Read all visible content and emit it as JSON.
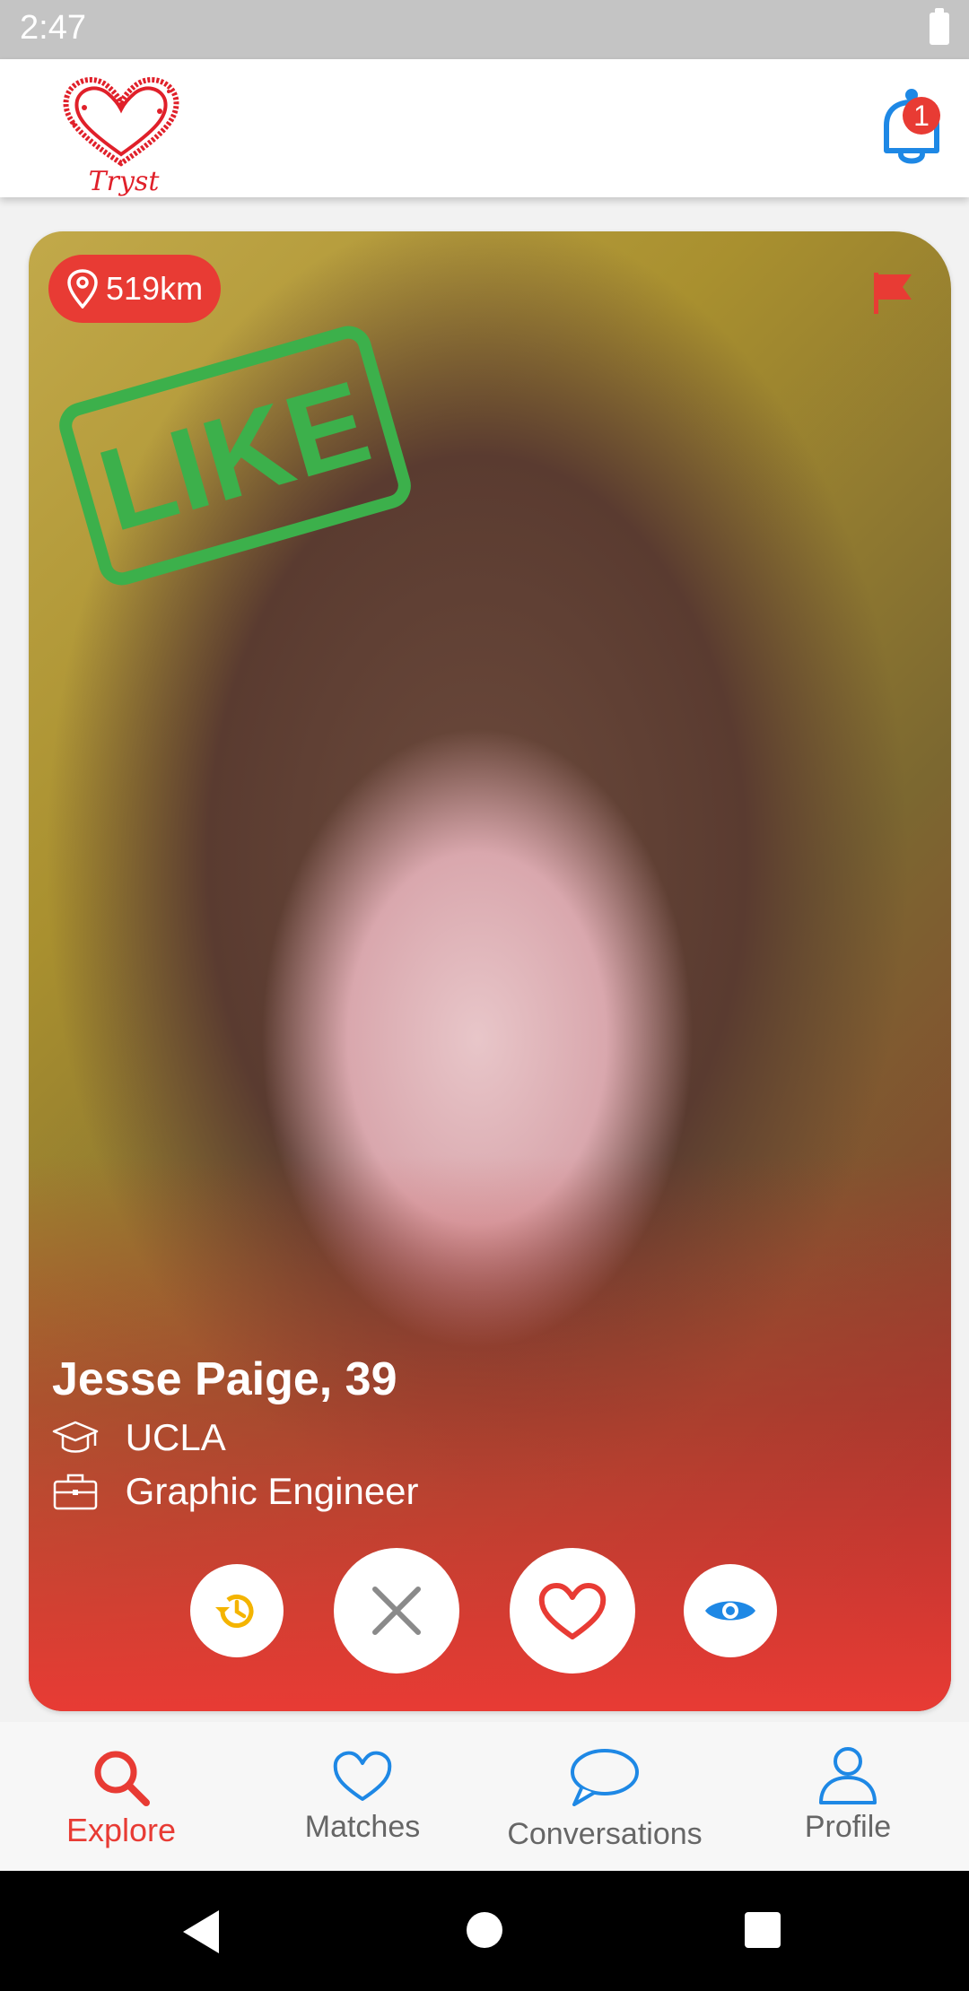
{
  "status_bar": {
    "time": "2:47"
  },
  "app_bar": {
    "logo_text": "Tryst",
    "notification_count": "1"
  },
  "card": {
    "distance": "519km",
    "stamp": "LIKE",
    "name_age": "Jesse Paige, 39",
    "school": "UCLA",
    "job": "Graphic Engineer"
  },
  "actions": {
    "rewind_icon": "history-icon",
    "dislike_icon": "close-icon",
    "like_icon": "heart-icon",
    "view_icon": "eye-icon"
  },
  "bottom_nav": {
    "items": [
      {
        "label": "Explore",
        "icon": "search-icon",
        "active": true
      },
      {
        "label": "Matches",
        "icon": "heart-outline-icon",
        "active": false
      },
      {
        "label": "Conversations",
        "icon": "chat-bubble-icon",
        "active": false
      },
      {
        "label": "Profile",
        "icon": "person-icon",
        "active": false
      }
    ]
  },
  "colors": {
    "accent_red": "#e83b34",
    "like_green": "#3cb04b",
    "blue": "#1e88e5",
    "rewind_yellow": "#f4b400",
    "nav_inactive": "#666666"
  }
}
